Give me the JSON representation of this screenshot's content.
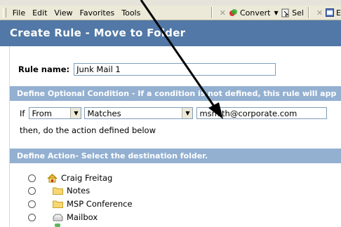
{
  "menubar": {
    "items": [
      "File",
      "Edit",
      "View",
      "Favorites",
      "Tools"
    ],
    "convert_label": "Convert",
    "sel_label": "Sel",
    "e_label": "E"
  },
  "header": {
    "title": "Create Rule - Move to Folder"
  },
  "form": {
    "rule_name_label": "Rule name:",
    "rule_name_value": "Junk Mail 1",
    "condition_heading": "Define Optional Condition - If a condition is not defined, this rule will app",
    "if_label": "If",
    "field_select": "From",
    "operator_select": "Matches",
    "condition_value": "msmith@corporate.com",
    "then_text": "then, do the action defined below",
    "action_heading": "Define Action- Select the destination folder."
  },
  "folders": [
    {
      "label": "Craig Freitag",
      "icon": "home-icon"
    },
    {
      "label": "Notes",
      "icon": "folder-icon"
    },
    {
      "label": "MSP Conference",
      "icon": "folder-icon"
    },
    {
      "label": "Mailbox",
      "icon": "mailbox-icon"
    }
  ],
  "colors": {
    "header_bg": "#5178a6",
    "section_bg": "#93b0d1",
    "annotation_arrow": "#000000"
  }
}
